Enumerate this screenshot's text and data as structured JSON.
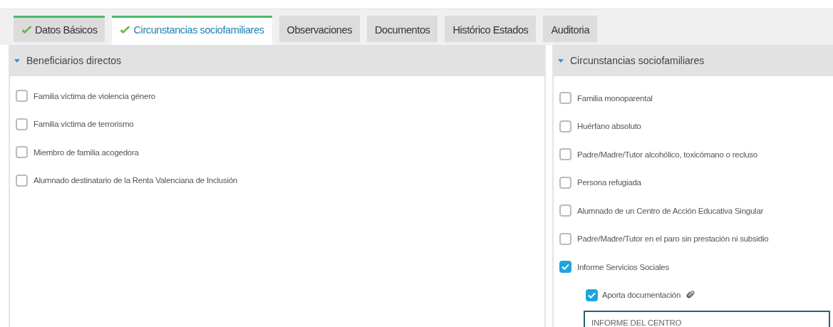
{
  "tabs": [
    {
      "label": "Datos Básicos",
      "checked": true,
      "selected": false
    },
    {
      "label": "Circunstancias sociofamiliares",
      "checked": true,
      "selected": true
    },
    {
      "label": "Observaciones",
      "checked": false,
      "selected": false
    },
    {
      "label": "Documentos",
      "checked": false,
      "selected": false
    },
    {
      "label": "Histórico Estados",
      "checked": false,
      "selected": false
    },
    {
      "label": "Auditoria",
      "checked": false,
      "selected": false
    }
  ],
  "left_panel": {
    "title": "Beneficiarios directos",
    "expanded": true,
    "items": [
      {
        "label": "Familia víctima de violencia género",
        "checked": false
      },
      {
        "label": "Familia víctima de terrorismo",
        "checked": false
      },
      {
        "label": "Miembro de familia acogedora",
        "checked": false
      },
      {
        "label": "Alumnado destinatario de la Renta Valenciana de Inclusión",
        "checked": false
      }
    ]
  },
  "right_panel": {
    "title": "Circunstancias sociofamiliares",
    "expanded": true,
    "items": [
      {
        "label": "Familia monoparental",
        "checked": false
      },
      {
        "label": "Huérfano absoluto",
        "checked": false
      },
      {
        "label": "Padre/Madre/Tutor alcohólico, toxicómano o recluso",
        "checked": false
      },
      {
        "label": "Persona refugiada",
        "checked": false
      },
      {
        "label": "Alumnado de un Centro de Acción Educativa Singular",
        "checked": false
      },
      {
        "label": "Padre/Madre/Tutor en el paro sin prestación ni subsidio",
        "checked": false
      },
      {
        "label": "Informe Servicios Sociales",
        "checked": true,
        "children": [
          {
            "label": "Aporta documentación",
            "checked": true,
            "attachment": true,
            "field": {
              "value": "INFORME DEL CENTRO"
            }
          }
        ]
      }
    ]
  }
}
